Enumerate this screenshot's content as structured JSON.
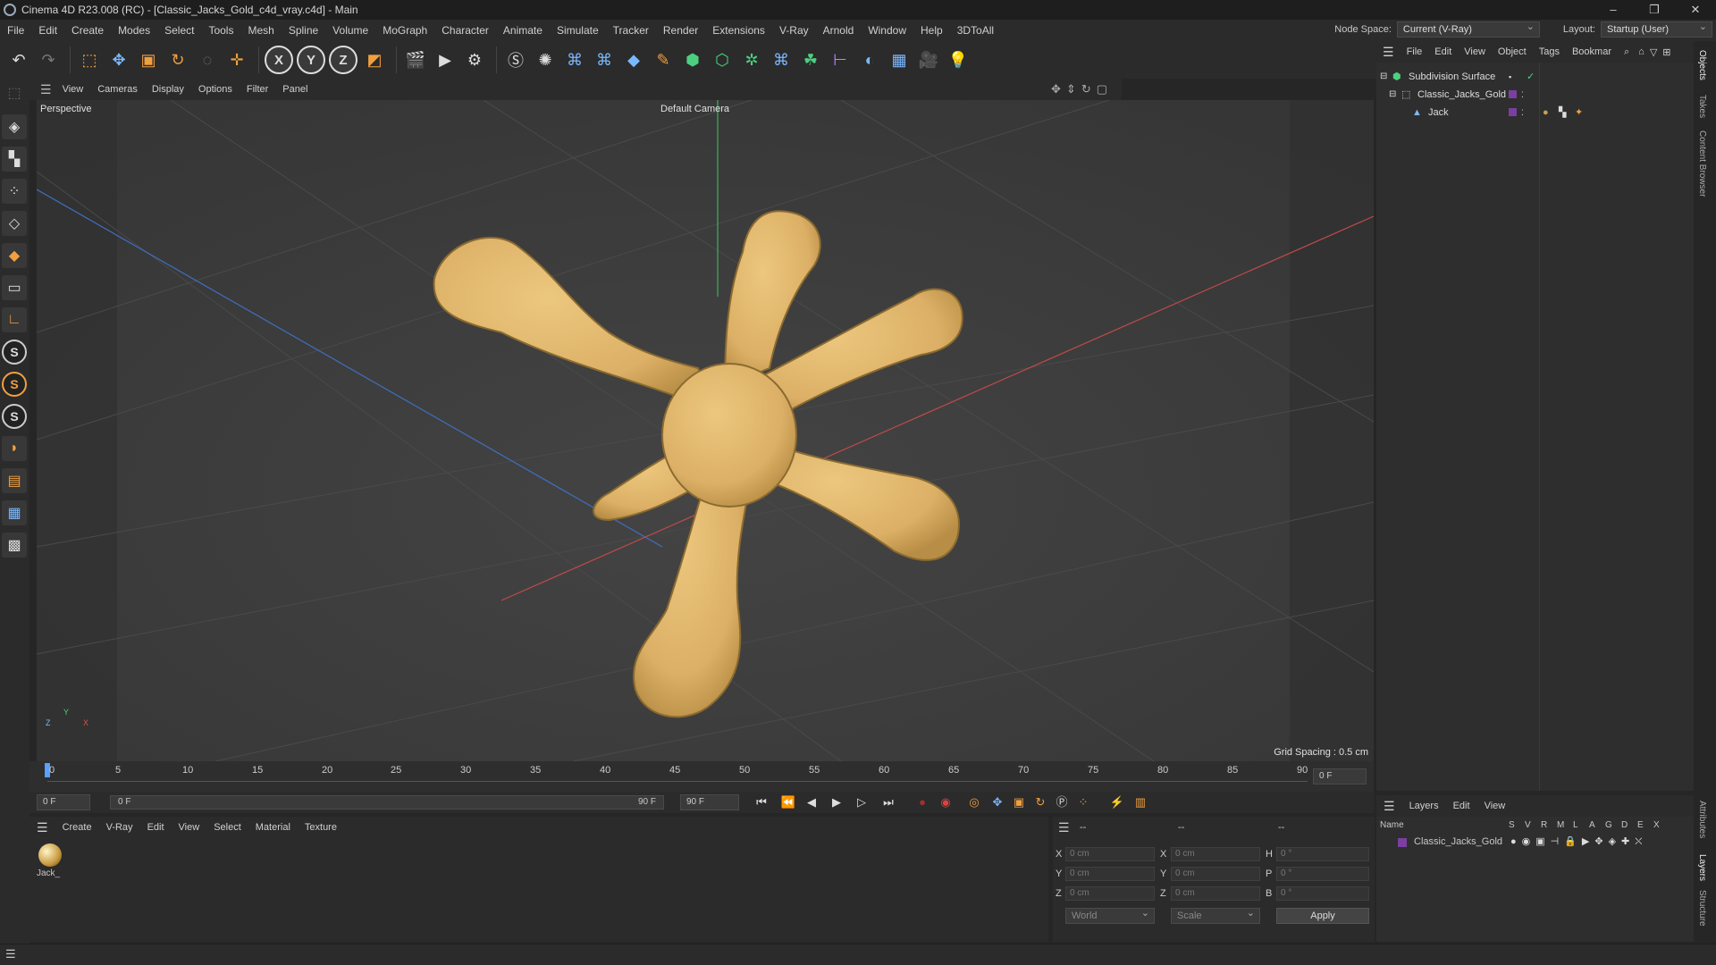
{
  "window": {
    "title": "Cinema 4D R23.008 (RC) - [Classic_Jacks_Gold_c4d_vray.c4d] - Main",
    "controls": [
      "–",
      "❐",
      "✕"
    ]
  },
  "menubar": {
    "items": [
      "File",
      "Edit",
      "Create",
      "Modes",
      "Select",
      "Tools",
      "Mesh",
      "Spline",
      "Volume",
      "MoGraph",
      "Character",
      "Animate",
      "Simulate",
      "Tracker",
      "Render",
      "Extensions",
      "V-Ray",
      "Arnold",
      "Window",
      "Help",
      "3DToAll"
    ],
    "node_space_label": "Node Space:",
    "node_space_value": "Current (V-Ray)",
    "layout_label": "Layout:",
    "layout_value": "Startup (User)"
  },
  "toolbar": {
    "axis_x": "X",
    "axis_y": "Y",
    "axis_z": "Z"
  },
  "viewport": {
    "menu": [
      "View",
      "Cameras",
      "Display",
      "Options",
      "Filter",
      "Panel"
    ],
    "view_name": "Perspective",
    "camera_name": "Default Camera",
    "grid_spacing": "Grid Spacing : 0.5 cm",
    "axis_x": "X",
    "axis_y": "Y",
    "axis_z": "Z",
    "object_color": "#e3b96c"
  },
  "timeline": {
    "ticks": [
      "0",
      "5",
      "10",
      "15",
      "20",
      "25",
      "30",
      "35",
      "40",
      "45",
      "50",
      "55",
      "60",
      "65",
      "70",
      "75",
      "80",
      "85",
      "90"
    ],
    "current_frame": "0 F",
    "start_frame": "0 F",
    "range_start": "0 F",
    "range_end": "90 F",
    "end_frame": "90 F"
  },
  "material_manager": {
    "menu": [
      "Create",
      "V-Ray",
      "Edit",
      "View",
      "Select",
      "Material",
      "Texture"
    ],
    "material_name": "Jack_"
  },
  "coordinates": {
    "header_dashes": [
      "--",
      "--",
      "--"
    ],
    "rows": [
      {
        "label": "X",
        "pos": "0 cm",
        "label2": "X",
        "size": "0 cm",
        "label3": "H",
        "rot": "0 °"
      },
      {
        "label": "Y",
        "pos": "0 cm",
        "label2": "Y",
        "size": "0 cm",
        "label3": "P",
        "rot": "0 °"
      },
      {
        "label": "Z",
        "pos": "0 cm",
        "label2": "Z",
        "size": "0 cm",
        "label3": "B",
        "rot": "0 °"
      }
    ],
    "world_dropdown": "World",
    "scale_dropdown": "Scale",
    "apply_label": "Apply"
  },
  "object_manager": {
    "menu": [
      "File",
      "Edit",
      "View",
      "Object",
      "Tags",
      "Bookmar"
    ],
    "objects": [
      {
        "name": "Subdivision Surface"
      },
      {
        "name": "Classic_Jacks_Gold"
      },
      {
        "name": "Jack"
      }
    ]
  },
  "layers": {
    "menu": [
      "Layers",
      "Edit",
      "View"
    ],
    "name_header": "Name",
    "flag_headers": [
      "S",
      "V",
      "R",
      "M",
      "L",
      "A",
      "G",
      "D",
      "E",
      "X"
    ],
    "layer_name": "Classic_Jacks_Gold",
    "layer_color": "#7a3fa0"
  },
  "right_tabs": [
    "Objects",
    "Takes",
    "Content Browser",
    "Attributes",
    "Layers",
    "Structure"
  ]
}
